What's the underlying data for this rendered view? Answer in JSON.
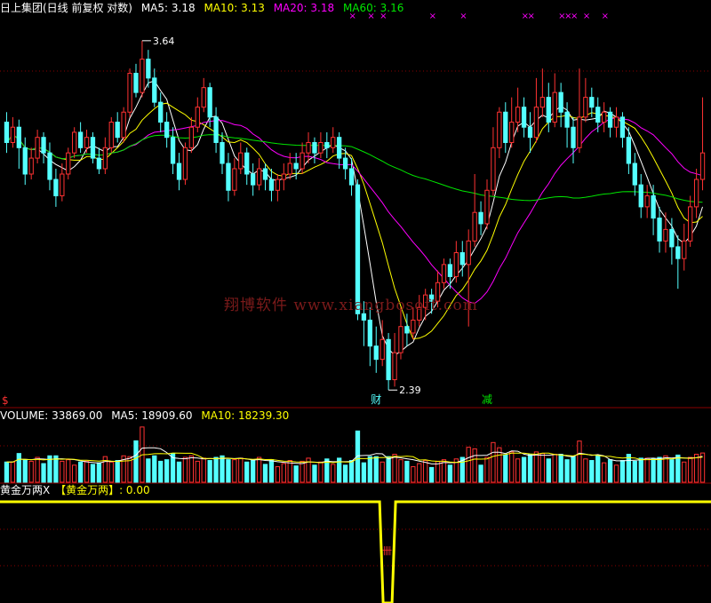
{
  "colors": {
    "background": "#000000",
    "up": "#ff3232",
    "down": "#54ffff",
    "ma5": "#ffffff",
    "ma10": "#ffff00",
    "ma20": "#ff00ff",
    "ma60": "#00e600",
    "grid": "#8a0000",
    "indicator": "#ffff00",
    "watermark": "#7a1a1a"
  },
  "header": {
    "title": "日上集团(日线 前复权 对数)",
    "ma5": "MA5: 3.18",
    "ma10": "MA10: 3.13",
    "ma20": "MA20: 3.18",
    "ma60": "MA60: 3.16"
  },
  "volume_header": {
    "label": "VOLUME: 33869.00",
    "ma5": "MA5: 18909.60",
    "ma10": "MA10: 18239.30"
  },
  "indicator_header": {
    "label": "黄金万两X",
    "value": "【黄金万两】: 0.00"
  },
  "annotations": {
    "high": "3.64",
    "low": "2.39",
    "marker_cai": "财",
    "marker_jian": "减",
    "marker_s": "$"
  },
  "watermark": "翔博软件 www.xiangbosoft.com",
  "chart_data": [
    {
      "type": "candlestick",
      "title": "日上集团(日线 前复权 对数)",
      "ylim": [
        2.35,
        3.75
      ],
      "highest_label": 3.64,
      "lowest_label": 2.39,
      "candles": [
        [
          3.3,
          3.22,
          3.34,
          3.18
        ],
        [
          3.22,
          3.28,
          3.32,
          3.2
        ],
        [
          3.28,
          3.2,
          3.31,
          3.12
        ],
        [
          3.2,
          3.1,
          3.24,
          3.06
        ],
        [
          3.1,
          3.16,
          3.2,
          3.08
        ],
        [
          3.16,
          3.24,
          3.27,
          3.14
        ],
        [
          3.24,
          3.18,
          3.26,
          3.14
        ],
        [
          3.18,
          3.08,
          3.22,
          3.04
        ],
        [
          3.08,
          3.02,
          3.12,
          2.98
        ],
        [
          3.02,
          3.1,
          3.14,
          3.0
        ],
        [
          3.1,
          3.18,
          3.2,
          3.08
        ],
        [
          3.18,
          3.26,
          3.28,
          3.16
        ],
        [
          3.26,
          3.2,
          3.3,
          3.18
        ],
        [
          3.2,
          3.24,
          3.27,
          3.18
        ],
        [
          3.24,
          3.16,
          3.26,
          3.14
        ],
        [
          3.16,
          3.12,
          3.2,
          3.1
        ],
        [
          3.12,
          3.2,
          3.24,
          3.1
        ],
        [
          3.2,
          3.3,
          3.32,
          3.18
        ],
        [
          3.3,
          3.24,
          3.34,
          3.22
        ],
        [
          3.24,
          3.34,
          3.36,
          3.22
        ],
        [
          3.34,
          3.5,
          3.52,
          3.32
        ],
        [
          3.5,
          3.42,
          3.54,
          3.4
        ],
        [
          3.42,
          3.56,
          3.64,
          3.4
        ],
        [
          3.56,
          3.48,
          3.6,
          3.44
        ],
        [
          3.48,
          3.38,
          3.52,
          3.36
        ],
        [
          3.38,
          3.3,
          3.42,
          3.26
        ],
        [
          3.3,
          3.24,
          3.34,
          3.2
        ],
        [
          3.24,
          3.14,
          3.28,
          3.1
        ],
        [
          3.14,
          3.08,
          3.18,
          3.04
        ],
        [
          3.08,
          3.2,
          3.22,
          3.06
        ],
        [
          3.2,
          3.28,
          3.32,
          3.18
        ],
        [
          3.28,
          3.36,
          3.4,
          3.26
        ],
        [
          3.36,
          3.44,
          3.48,
          3.34
        ],
        [
          3.44,
          3.32,
          3.46,
          3.28
        ],
        [
          3.32,
          3.22,
          3.36,
          3.18
        ],
        [
          3.22,
          3.14,
          3.26,
          3.1
        ],
        [
          3.14,
          3.04,
          3.18,
          3.0
        ],
        [
          3.04,
          3.12,
          3.16,
          3.02
        ],
        [
          3.12,
          3.18,
          3.22,
          3.1
        ],
        [
          3.18,
          3.1,
          3.2,
          3.06
        ],
        [
          3.1,
          3.06,
          3.14,
          3.02
        ],
        [
          3.06,
          3.12,
          3.16,
          3.04
        ],
        [
          3.12,
          3.08,
          3.14,
          3.04
        ],
        [
          3.08,
          3.04,
          3.12,
          3.0
        ],
        [
          3.04,
          3.08,
          3.1,
          3.0
        ],
        [
          3.08,
          3.1,
          3.14,
          3.04
        ],
        [
          3.1,
          3.14,
          3.18,
          3.08
        ],
        [
          3.14,
          3.12,
          3.18,
          3.08
        ],
        [
          3.12,
          3.18,
          3.22,
          3.1
        ],
        [
          3.18,
          3.22,
          3.26,
          3.14
        ],
        [
          3.22,
          3.18,
          3.24,
          3.14
        ],
        [
          3.18,
          3.22,
          3.26,
          3.16
        ],
        [
          3.22,
          3.2,
          3.26,
          3.16
        ],
        [
          3.2,
          3.24,
          3.28,
          3.18
        ],
        [
          3.24,
          3.16,
          3.26,
          3.12
        ],
        [
          3.16,
          3.12,
          3.2,
          3.08
        ],
        [
          3.12,
          3.06,
          3.16,
          3.02
        ],
        [
          3.06,
          2.62,
          3.08,
          2.6
        ],
        [
          2.62,
          2.6,
          2.66,
          2.52
        ],
        [
          2.6,
          2.52,
          2.64,
          2.46
        ],
        [
          2.52,
          2.48,
          2.58,
          2.44
        ],
        [
          2.48,
          2.54,
          2.6,
          2.46
        ],
        [
          2.54,
          2.42,
          2.56,
          2.39
        ],
        [
          2.42,
          2.5,
          2.56,
          2.4
        ],
        [
          2.5,
          2.58,
          2.64,
          2.48
        ],
        [
          2.58,
          2.56,
          2.62,
          2.52
        ],
        [
          2.56,
          2.6,
          2.64,
          2.54
        ],
        [
          2.6,
          2.64,
          2.68,
          2.58
        ],
        [
          2.64,
          2.68,
          2.7,
          2.6
        ],
        [
          2.68,
          2.66,
          2.7,
          2.62
        ],
        [
          2.66,
          2.72,
          2.76,
          2.64
        ],
        [
          2.72,
          2.78,
          2.8,
          2.7
        ],
        [
          2.78,
          2.74,
          2.8,
          2.7
        ],
        [
          2.74,
          2.82,
          2.86,
          2.72
        ],
        [
          2.82,
          2.78,
          2.86,
          2.74
        ],
        [
          2.78,
          2.86,
          2.9,
          2.58
        ],
        [
          2.86,
          2.96,
          3.1,
          2.84
        ],
        [
          2.96,
          2.92,
          3.0,
          2.88
        ],
        [
          2.92,
          3.04,
          3.08,
          2.9
        ],
        [
          3.04,
          3.2,
          3.28,
          3.02
        ],
        [
          3.2,
          3.34,
          3.36,
          3.16
        ],
        [
          3.34,
          3.22,
          3.38,
          3.18
        ],
        [
          3.22,
          3.3,
          3.4,
          3.2
        ],
        [
          3.3,
          3.36,
          3.44,
          3.26
        ],
        [
          3.36,
          3.28,
          3.4,
          3.24
        ],
        [
          3.28,
          3.24,
          3.34,
          3.18
        ],
        [
          3.24,
          3.36,
          3.48,
          3.22
        ],
        [
          3.36,
          3.4,
          3.52,
          3.32
        ],
        [
          3.4,
          3.3,
          3.46,
          3.26
        ],
        [
          3.3,
          3.42,
          3.5,
          3.28
        ],
        [
          3.42,
          3.34,
          3.46,
          3.28
        ],
        [
          3.34,
          3.28,
          3.38,
          3.2
        ],
        [
          3.28,
          3.2,
          3.32,
          3.14
        ],
        [
          3.2,
          3.32,
          3.52,
          3.18
        ],
        [
          3.32,
          3.4,
          3.48,
          3.3
        ],
        [
          3.4,
          3.36,
          3.44,
          3.32
        ],
        [
          3.36,
          3.3,
          3.4,
          3.26
        ],
        [
          3.3,
          3.34,
          3.38,
          3.26
        ],
        [
          3.34,
          3.28,
          3.36,
          3.24
        ],
        [
          3.28,
          3.32,
          3.36,
          3.24
        ],
        [
          3.32,
          3.24,
          3.34,
          3.2
        ],
        [
          3.24,
          3.14,
          3.28,
          3.1
        ],
        [
          3.14,
          3.06,
          3.18,
          3.02
        ],
        [
          3.06,
          2.98,
          3.1,
          2.94
        ],
        [
          2.98,
          3.02,
          3.06,
          2.94
        ],
        [
          3.02,
          2.94,
          3.06,
          2.88
        ],
        [
          2.94,
          2.86,
          2.98,
          2.82
        ],
        [
          2.86,
          2.9,
          2.96,
          2.82
        ],
        [
          2.9,
          2.84,
          2.94,
          2.78
        ],
        [
          2.84,
          2.8,
          2.88,
          2.7
        ],
        [
          2.8,
          2.86,
          2.92,
          2.76
        ],
        [
          2.86,
          2.98,
          3.02,
          2.84
        ],
        [
          2.98,
          3.08,
          3.12,
          2.94
        ],
        [
          3.08,
          3.18,
          3.4,
          3.04
        ]
      ],
      "ma_lines": [
        {
          "name": "MA5",
          "color": "#ffffff"
        },
        {
          "name": "MA10",
          "color": "#ffff00"
        },
        {
          "name": "MA20",
          "color": "#ff00ff"
        },
        {
          "name": "MA60",
          "color": "#00e600"
        }
      ],
      "special_markers": [
        {
          "index": 60,
          "label": "财"
        },
        {
          "index": 78,
          "label": "减"
        },
        {
          "index": 0,
          "label": "$"
        }
      ],
      "top_markers_indices": [
        56,
        59,
        61,
        69,
        74,
        84,
        85,
        90,
        91,
        92,
        94,
        97
      ]
    },
    {
      "type": "bar",
      "title": "VOLUME",
      "ylim": [
        0,
        70000
      ],
      "last_value": 33869,
      "ma5_last": 18909.6,
      "ma10_last": 18239.3
    },
    {
      "type": "line",
      "title": "黄金万两X",
      "value": 0.0,
      "ylim": [
        0,
        1
      ],
      "signal_indices": [
        62
      ]
    }
  ]
}
